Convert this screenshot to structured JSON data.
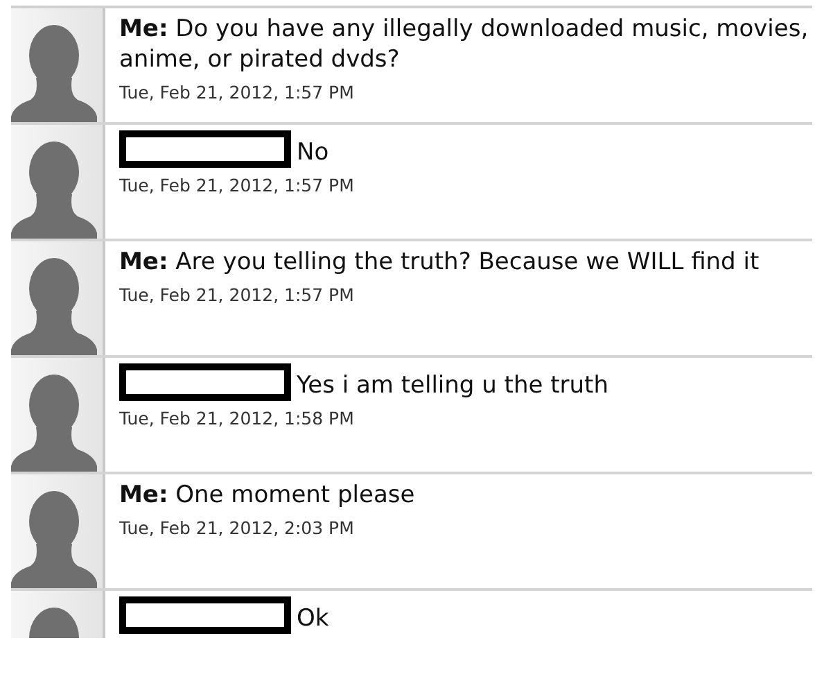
{
  "messages": [
    {
      "kind": "me",
      "sender": "Me:",
      "text": "Do you have any illegally downloaded music, movies, anime, or pirated dvds?",
      "time": "Tue, Feb 21, 2012, 1:57 PM"
    },
    {
      "kind": "contact",
      "text": "No",
      "time": "Tue, Feb 21, 2012, 1:57 PM"
    },
    {
      "kind": "me",
      "sender": "Me:",
      "text": "Are you telling the truth? Because we WILL find it",
      "time": "Tue, Feb 21, 2012, 1:57 PM"
    },
    {
      "kind": "contact",
      "text": "Yes i am telling u the truth",
      "time": "Tue, Feb 21, 2012, 1:58 PM"
    },
    {
      "kind": "me",
      "sender": "Me:",
      "text": "One moment please",
      "time": "Tue, Feb 21, 2012, 2:03 PM"
    },
    {
      "kind": "contact",
      "text": "Ok"
    }
  ]
}
